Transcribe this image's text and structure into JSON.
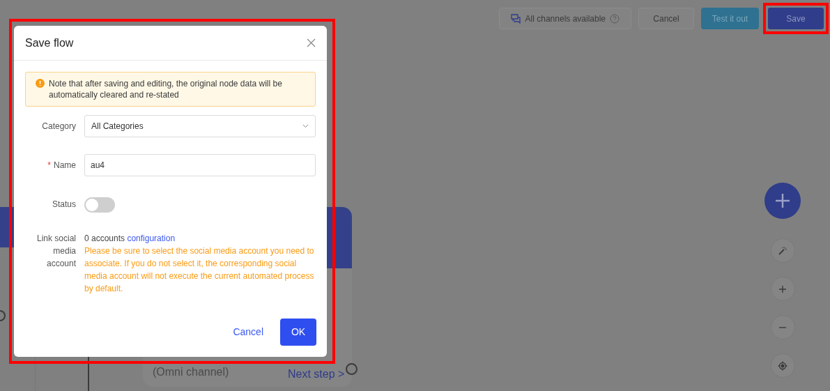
{
  "toolbar": {
    "channels": "All channels available",
    "buttons": [
      {
        "kind": "plain",
        "label": "Cancel"
      },
      {
        "kind": "test",
        "label": "Test it out"
      },
      {
        "kind": "primary",
        "label": "Save",
        "highlighted": true
      }
    ]
  },
  "canvas": {
    "node": {
      "channel": "(Omni channel)",
      "next": "Next step >"
    }
  },
  "dialog": {
    "title": "Save flow",
    "highlighted": true,
    "alert": "Note that after saving and editing, the original node data will be automatically cleared and re-stated",
    "fields": [
      {
        "kind": "select",
        "label": "Category",
        "value": "All Categories"
      },
      {
        "kind": "text",
        "label": "Name",
        "marker": "*",
        "value": "au4"
      },
      {
        "kind": "switch",
        "label": "Status",
        "on": false
      },
      {
        "kind": "accounts",
        "label": "Link social media account",
        "count": "0 accounts",
        "link": "configuration",
        "warning": "Please be sure to select the social media account you need to associate. If you do not select it, the corresponding social media account will not execute the current automated process by default."
      }
    ],
    "cancel": "Cancel",
    "ok": "OK"
  }
}
